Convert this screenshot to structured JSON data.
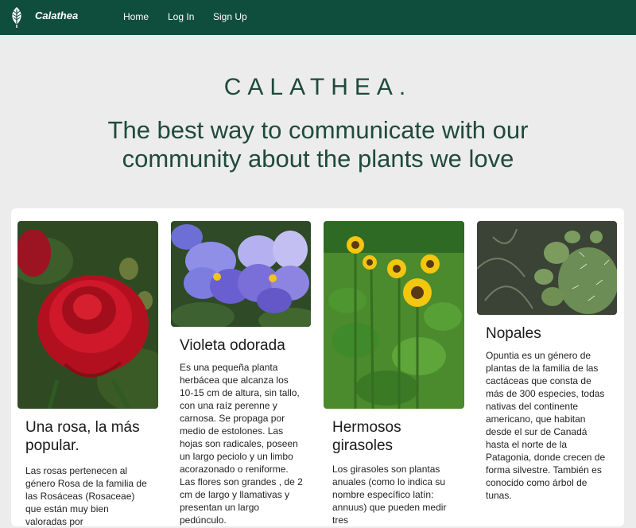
{
  "nav": {
    "brand": "Calathea",
    "links": [
      "Home",
      "Log In",
      "Sign Up"
    ]
  },
  "hero": {
    "title": "CALATHEA.",
    "subtitle": "The best way to communicate with our community about the plants we love"
  },
  "cards": [
    {
      "title": "Una rosa, la más popular.",
      "text": "Las rosas pertenecen al género Rosa de la familia de las Rosáceas (Rosaceae) que están muy bien valoradas por"
    },
    {
      "title": "Violeta odorada",
      "text": "Es una pequeña planta herbácea que alcanza los 10-15 cm de altura, sin tallo, con una raíz perenne y carnosa. Se propaga por medio de estolones. Las hojas son radicales, poseen un largo peciolo y un limbo acorazonado o reniforme. Las flores son grandes , de 2 cm de largo y llamativas y presentan un largo pedúnculo."
    },
    {
      "title": "Hermosos girasoles",
      "text": "Los girasoles son plantas anuales (como lo indica su nombre específico latín: annuus) que pueden medir tres"
    },
    {
      "title": "Nopales",
      "text": "Opuntia es un género de plantas de la familia de las cactáceas que consta de más de 300 especies, todas nativas del continente americano, que habitan desde el sur de Canadá hasta el norte de la Patagonia, donde crecen de forma silvestre. También es conocido como árbol de tunas."
    }
  ],
  "colors": {
    "navbar": "#0f4d3d",
    "accent": "#1f4a3c",
    "background": "#ececec"
  }
}
